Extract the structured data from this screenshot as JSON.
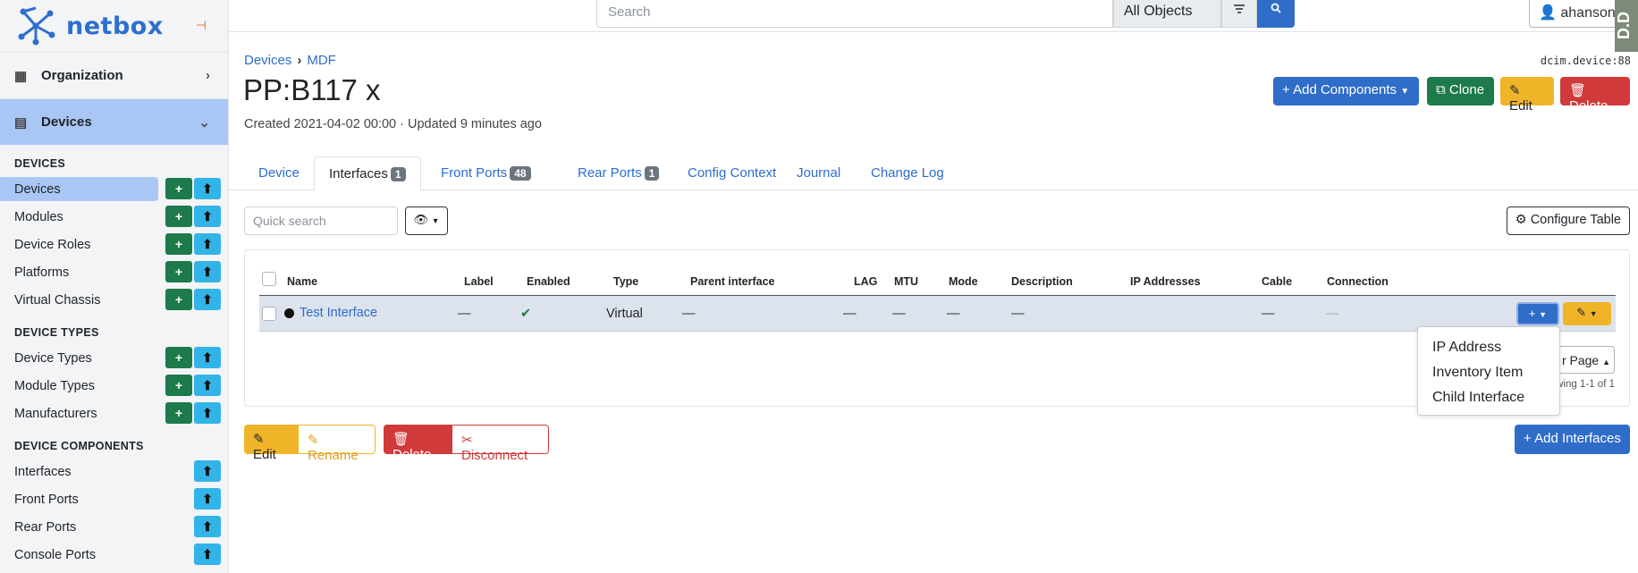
{
  "brand": {
    "name": "netbox"
  },
  "sidebar": {
    "top": [
      {
        "label": "Organization",
        "icon": "organization-icon"
      },
      {
        "label": "Devices",
        "icon": "devices-icon"
      }
    ],
    "sections": [
      {
        "title": "DEVICES",
        "items": [
          {
            "label": "Devices",
            "add": true,
            "active": true
          },
          {
            "label": "Modules",
            "add": true
          },
          {
            "label": "Device Roles",
            "add": true
          },
          {
            "label": "Platforms",
            "add": true
          },
          {
            "label": "Virtual Chassis",
            "add": true
          }
        ]
      },
      {
        "title": "DEVICE TYPES",
        "items": [
          {
            "label": "Device Types",
            "add": true
          },
          {
            "label": "Module Types",
            "add": true
          },
          {
            "label": "Manufacturers",
            "add": true
          }
        ]
      },
      {
        "title": "DEVICE COMPONENTS",
        "items": [
          {
            "label": "Interfaces",
            "add": false
          },
          {
            "label": "Front Ports",
            "add": false
          },
          {
            "label": "Rear Ports",
            "add": false
          },
          {
            "label": "Console Ports",
            "add": false
          }
        ]
      }
    ]
  },
  "topbar": {
    "search_placeholder": "Search",
    "scope": "All Objects",
    "user": "ahanson",
    "corner_text": "D.D"
  },
  "page": {
    "breadcrumb": [
      "Devices",
      "MDF"
    ],
    "object_id": "dcim.device:88",
    "title": "PP:B117 x",
    "meta": "Created 2021-04-02 00:00 · Updated 9 minutes ago",
    "buttons": {
      "add_components": "Add Components",
      "clone": "Clone",
      "edit": "Edit",
      "delete": "Delete"
    }
  },
  "tabs": [
    {
      "label": "Device"
    },
    {
      "label": "Interfaces",
      "badge": "1",
      "active": true
    },
    {
      "label": "Front Ports",
      "badge": "48"
    },
    {
      "label": "Rear Ports",
      "badge": "1"
    },
    {
      "label": "Config Context"
    },
    {
      "label": "Journal"
    },
    {
      "label": "Change Log"
    }
  ],
  "table": {
    "quick_search_placeholder": "Quick search",
    "configure_label": "Configure Table",
    "columns": [
      "Name",
      "Label",
      "Enabled",
      "Type",
      "Parent interface",
      "LAG",
      "MTU",
      "Mode",
      "Description",
      "IP Addresses",
      "Cable",
      "Connection"
    ],
    "row": {
      "name": "Test Interface",
      "label": "—",
      "enabled": "✔",
      "type": "Virtual",
      "parent": "—",
      "lag": "—",
      "mtu": "—",
      "mode": "—",
      "description": "—",
      "cable": "—",
      "connection": "—"
    },
    "per_page_label": "r Page",
    "showing": "wing 1-1 of 1"
  },
  "dropdown": {
    "items": [
      "IP Address",
      "Inventory Item",
      "Child Interface"
    ]
  },
  "bottom": {
    "edit": "Edit",
    "rename": "Rename",
    "delete": "Delete",
    "disconnect": "Disconnect",
    "add_interfaces": "Add Interfaces"
  }
}
